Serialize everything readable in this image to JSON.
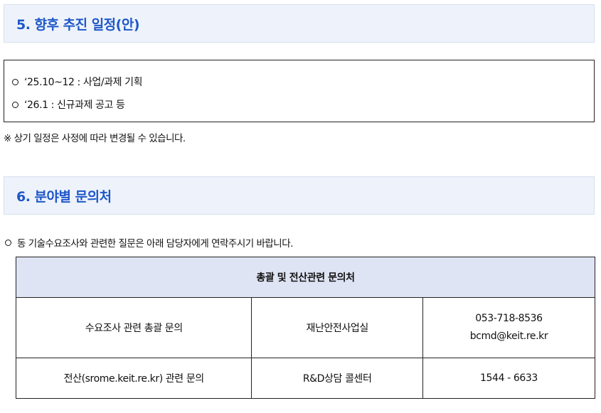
{
  "sections": {
    "schedule": {
      "title": "5. 향후 추진 일정(안)",
      "items": [
        "‘25.10~12 : 사업/과제 기획",
        "‘26.1 : 신규과제 공고 등"
      ],
      "note": "※ 상기 일정은 사정에 따라 변경될 수 있습니다."
    },
    "contacts": {
      "title": "6. 분야별 문의처",
      "intro": "동 기술수요조사와 관련한 질문은 아래 담당자에게 연락주시기 바랍니다.",
      "table": {
        "header": "총괄 및 전산관련 문의처",
        "rows": [
          {
            "topic": "수요조사 관련 총괄 문의",
            "department": "재난안전사업실",
            "phone": "053-718-8536",
            "email": "bcmd@keit.re.kr"
          },
          {
            "topic": "전산(srome.keit.re.kr) 관련 문의",
            "department": "R&D상담 콜센터",
            "phone": "1544 - 6633"
          }
        ]
      }
    }
  }
}
